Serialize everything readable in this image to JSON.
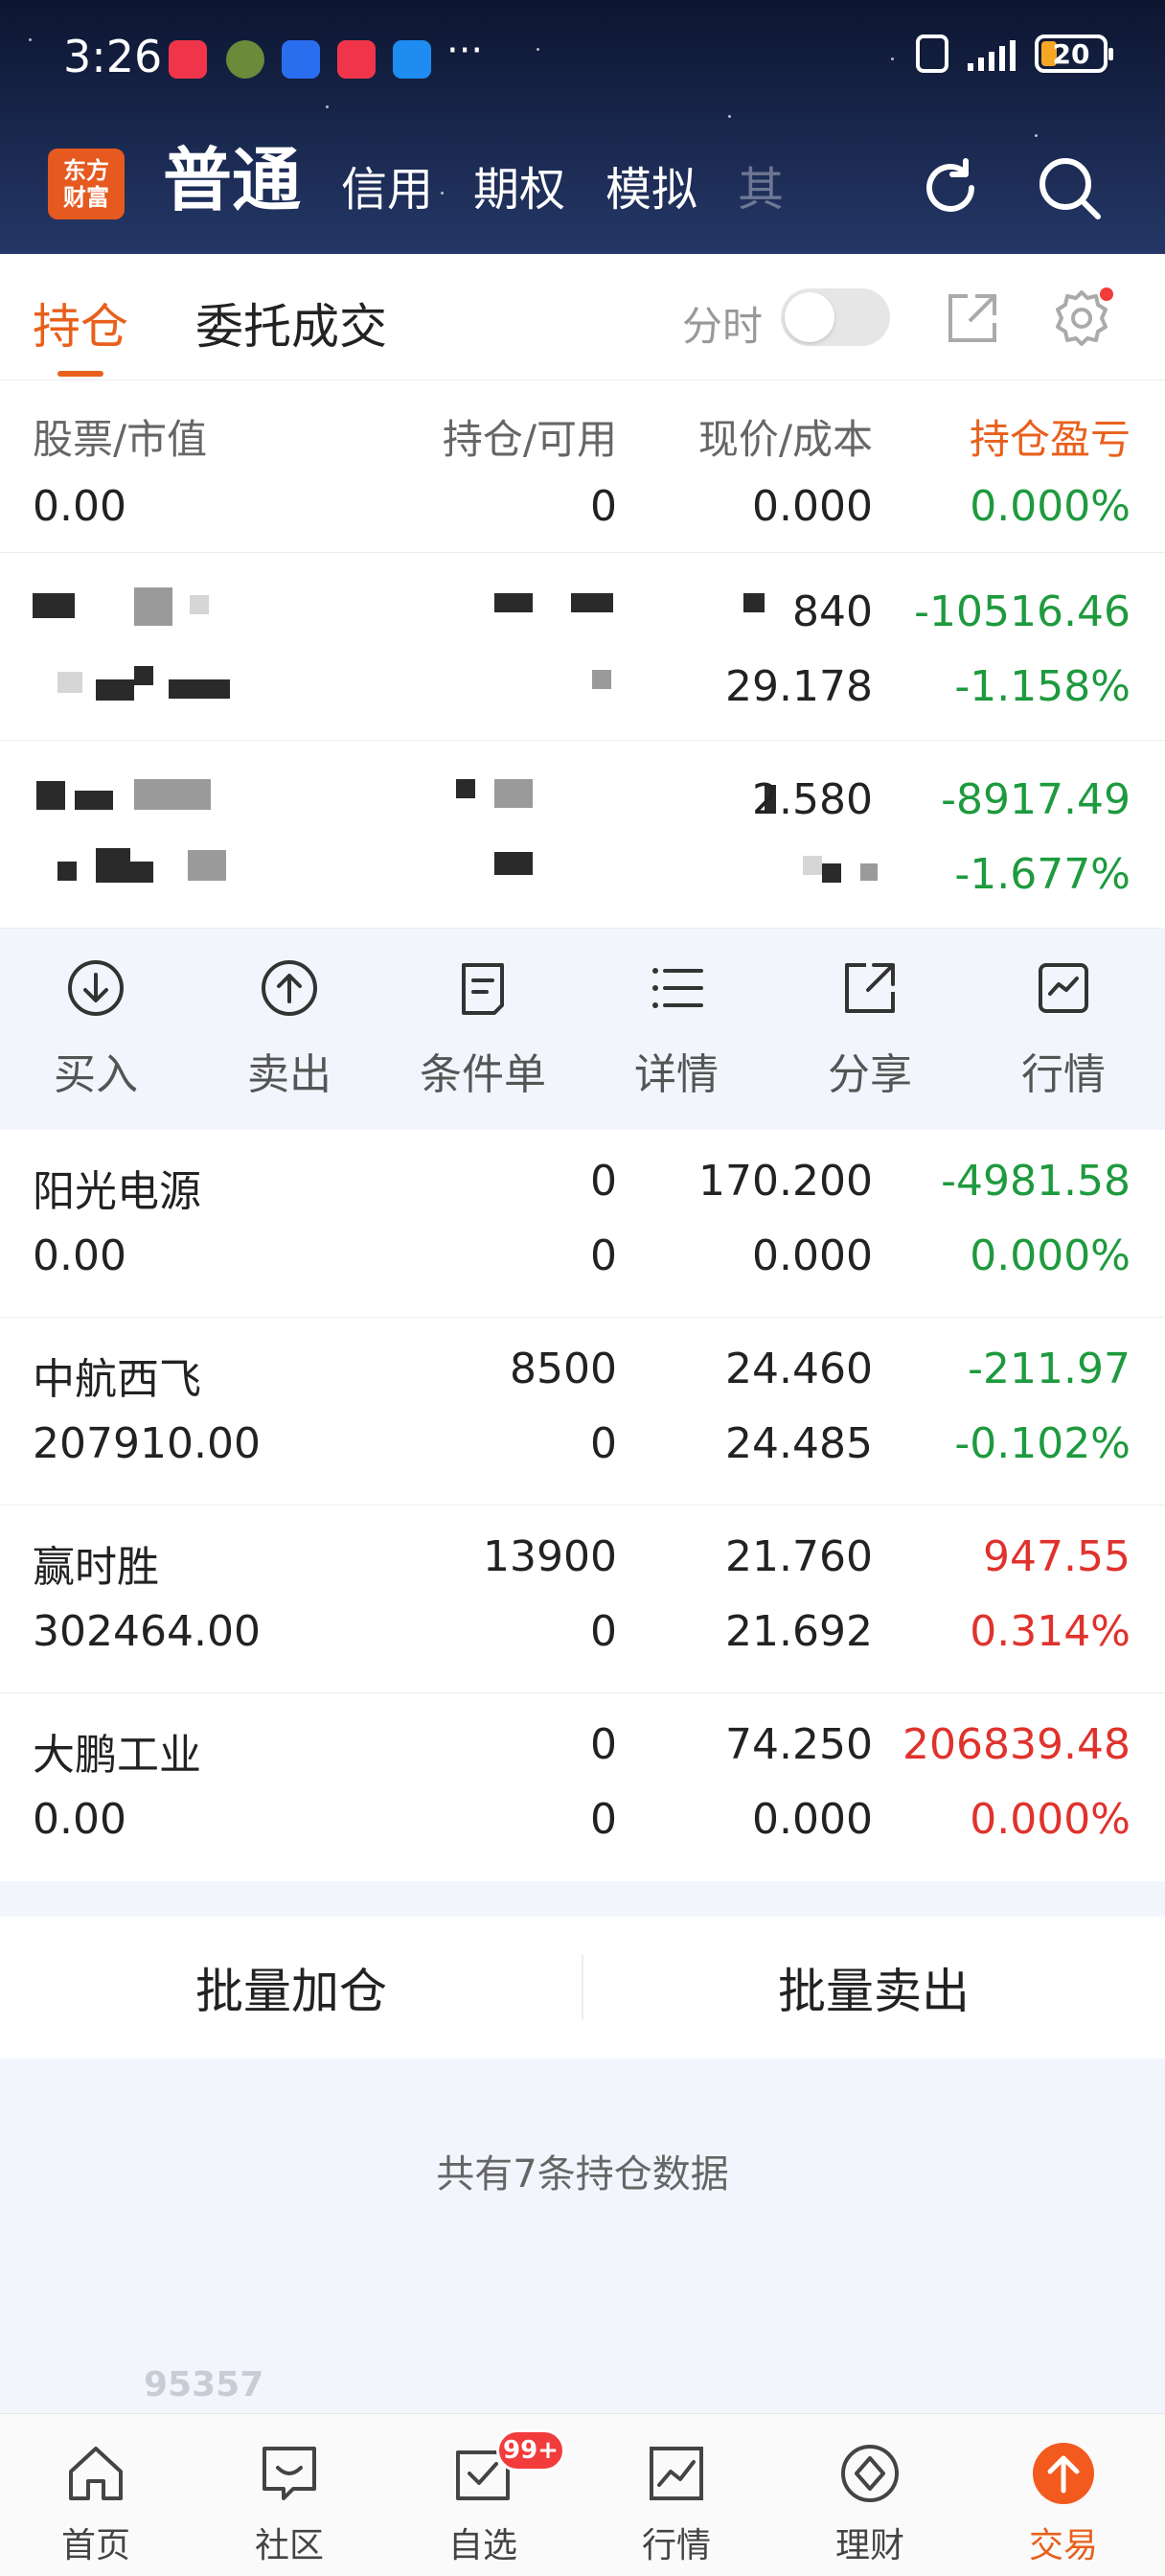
{
  "status_bar": {
    "time": "3:26",
    "battery": "20",
    "more": "···"
  },
  "header": {
    "logo_line1": "东方",
    "logo_line2": "财富",
    "account_tabs": [
      "普通",
      "信用",
      "期权",
      "模拟",
      "其"
    ]
  },
  "subtabs": {
    "holdings": "持仓",
    "orders": "委托成交",
    "fenshi": "分时"
  },
  "table": {
    "headers": {
      "stock_value": "股票/市值",
      "pos_avail": "持仓/可用",
      "price_cost": "现价/成本",
      "pnl": "持仓盈亏"
    },
    "top_row": {
      "value": "0.00",
      "avail": "0",
      "cost": "0.000",
      "pct": "0.000%"
    },
    "masked_rows": [
      {
        "price": "840",
        "cost": "29.178",
        "pnl": "-10516.46",
        "pct": "-1.158%"
      },
      {
        "price": "2.580",
        "pnl": "-8917.49",
        "pct": "-1.677%"
      }
    ],
    "actions": [
      "买入",
      "卖出",
      "条件单",
      "详情",
      "分享",
      "行情"
    ],
    "rows": [
      {
        "name": "阳光电源",
        "value": "0.00",
        "pos": "0",
        "avail": "0",
        "price": "170.200",
        "cost": "0.000",
        "pnl": "-4981.58",
        "pct": "0.000%"
      },
      {
        "name": "中航西飞",
        "value": "207910.00",
        "pos": "8500",
        "avail": "0",
        "price": "24.460",
        "cost": "24.485",
        "pnl": "-211.97",
        "pct": "-0.102%"
      },
      {
        "name": "赢时胜",
        "value": "302464.00",
        "pos": "13900",
        "avail": "0",
        "price": "21.760",
        "cost": "21.692",
        "pnl": "947.55",
        "pct": "0.314%"
      },
      {
        "name": "大鹏工业",
        "value": "0.00",
        "pos": "0",
        "avail": "0",
        "price": "74.250",
        "cost": "0.000",
        "pnl": "206839.48",
        "pct": "0.000%"
      }
    ]
  },
  "batch": {
    "add": "批量加仓",
    "sell": "批量卖出"
  },
  "summary": "共有7条持仓数据",
  "ghost_number": "95357",
  "bottom_nav": {
    "items": [
      "首页",
      "社区",
      "自选",
      "行情",
      "理财",
      "交易"
    ],
    "badge": "99+"
  },
  "colors": {
    "accent": "#e8601c",
    "gain": "#e0322c",
    "loss": "#1e9a3e"
  }
}
